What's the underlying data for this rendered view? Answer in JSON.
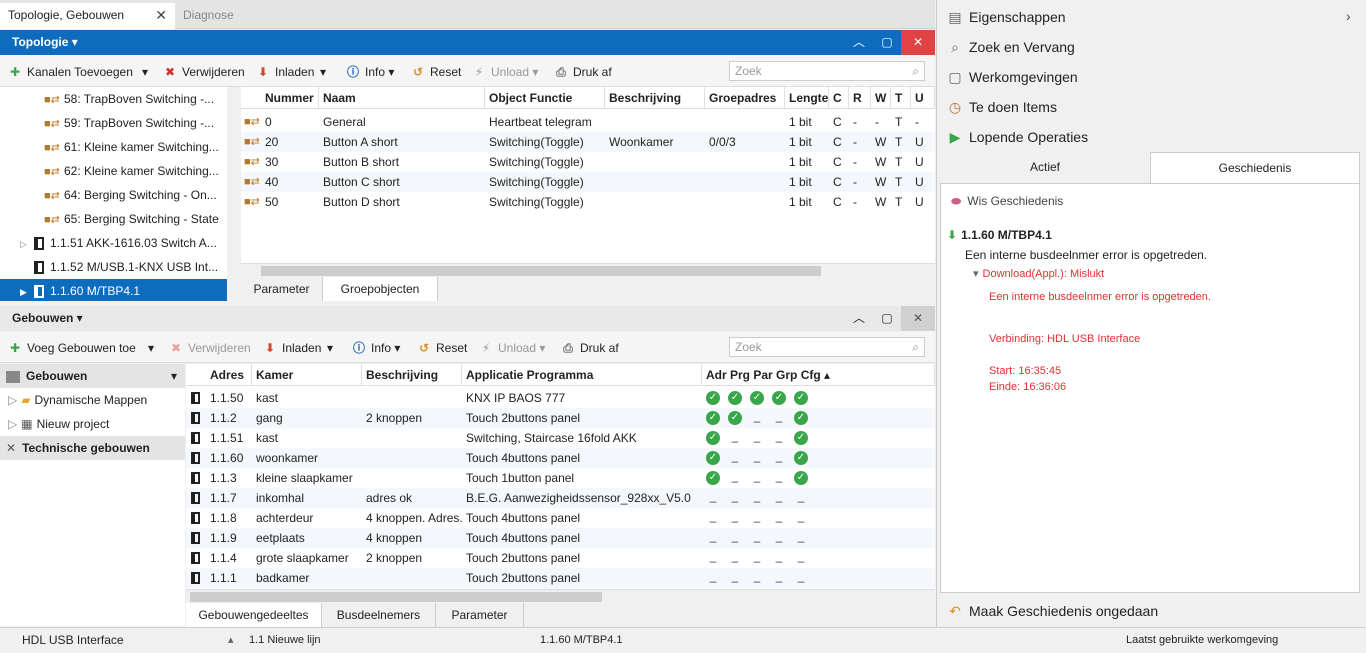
{
  "doc_tabs": {
    "active": "Topologie, Gebouwen",
    "inactive": "Diagnose",
    "close": "✕"
  },
  "topology": {
    "header": "Topologie ▾",
    "toolbar": {
      "add": "Kanalen Toevoegen",
      "remove": "Verwijderen",
      "load": "Inladen",
      "info": "Info",
      "reset": "Reset",
      "unload": "Unload",
      "print": "Druk af",
      "search_placeholder": "Zoek"
    },
    "tree": [
      {
        "label": "58: TrapBoven Switching  -...",
        "type": "co"
      },
      {
        "label": "59: TrapBoven Switching  -...",
        "type": "co"
      },
      {
        "label": "61: Kleine kamer Switching...",
        "type": "co"
      },
      {
        "label": "62: Kleine kamer Switching...",
        "type": "co"
      },
      {
        "label": "64: Berging Switching  - On...",
        "type": "co"
      },
      {
        "label": "65: Berging Switching  - State",
        "type": "co"
      },
      {
        "label": "1.1.51 AKK-1616.03 Switch A...",
        "type": "dev"
      },
      {
        "label": "1.1.52 M/USB.1-KNX USB Int...",
        "type": "dev"
      },
      {
        "label": "1.1.60 M/TBP4.1",
        "type": "dev",
        "selected": true
      }
    ],
    "columns": [
      "Nummer",
      "Naam",
      "Object Functie",
      "Beschrijving",
      "Groepadres",
      "Lengte",
      "C",
      "R",
      "W",
      "T",
      "U"
    ],
    "rows": [
      [
        "0",
        "General",
        "Heartbeat telegram",
        "",
        "",
        "1 bit",
        "C",
        "-",
        "-",
        "T",
        "-"
      ],
      [
        "20",
        "Button A short",
        "Switching(Toggle)",
        "Woonkamer",
        "0/0/3",
        "1 bit",
        "C",
        "-",
        "W",
        "T",
        "U"
      ],
      [
        "30",
        "Button B short",
        "Switching(Toggle)",
        "",
        "",
        "1 bit",
        "C",
        "-",
        "W",
        "T",
        "U"
      ],
      [
        "40",
        "Button C short",
        "Switching(Toggle)",
        "",
        "",
        "1 bit",
        "C",
        "-",
        "W",
        "T",
        "U"
      ],
      [
        "50",
        "Button D short",
        "Switching(Toggle)",
        "",
        "",
        "1 bit",
        "C",
        "-",
        "W",
        "T",
        "U"
      ]
    ],
    "bottom_tabs": [
      "Parameter",
      "Groepobjecten"
    ]
  },
  "buildings": {
    "header": "Gebouwen ▾",
    "toolbar": {
      "add": "Voeg Gebouwen toe",
      "remove": "Verwijderen",
      "load": "Inladen",
      "info": "Info",
      "reset": "Reset",
      "unload": "Unload",
      "print": "Druk af",
      "search_placeholder": "Zoek"
    },
    "sidebar_header": "Gebouwen",
    "tree": [
      "Dynamische Mappen",
      "Nieuw project"
    ],
    "tech_label": "Technische gebouwen",
    "columns": [
      "Adres",
      "Kamer",
      "Beschrijving",
      "Applicatie Programma",
      "Adr Prg Par Grp Cfg ▴"
    ],
    "rows": [
      {
        "adres": "1.1.50",
        "kamer": "kast",
        "beschr": "",
        "app": "KNX IP BAOS 777",
        "status": [
          1,
          1,
          1,
          1,
          1
        ]
      },
      {
        "adres": "1.1.2",
        "kamer": "gang",
        "beschr": "2 knoppen",
        "app": "Touch 2buttons panel",
        "status": [
          1,
          1,
          0,
          0,
          1
        ]
      },
      {
        "adres": "1.1.51",
        "kamer": "kast",
        "beschr": "",
        "app": "Switching, Staircase 16fold AKK",
        "status": [
          1,
          0,
          0,
          0,
          1
        ]
      },
      {
        "adres": "1.1.60",
        "kamer": "woonkamer",
        "beschr": "",
        "app": "Touch 4buttons panel",
        "status": [
          1,
          0,
          0,
          0,
          1
        ]
      },
      {
        "adres": "1.1.3",
        "kamer": "kleine slaapkamer",
        "beschr": "",
        "app": "Touch 1button panel",
        "status": [
          1,
          0,
          0,
          0,
          1
        ]
      },
      {
        "adres": "1.1.7",
        "kamer": "inkomhal",
        "beschr": "adres ok",
        "app": "B.E.G. Aanwezigheidssensor_928xx_V5.0",
        "status": [
          0,
          0,
          0,
          0,
          0
        ]
      },
      {
        "adres": "1.1.8",
        "kamer": "achterdeur",
        "beschr": "4 knoppen. Adres...",
        "app": "Touch 4buttons panel",
        "status": [
          0,
          0,
          0,
          0,
          0
        ]
      },
      {
        "adres": "1.1.9",
        "kamer": "eetplaats",
        "beschr": "4 knoppen",
        "app": "Touch 4buttons panel",
        "status": [
          0,
          0,
          0,
          0,
          0
        ]
      },
      {
        "adres": "1.1.4",
        "kamer": "grote slaapkamer",
        "beschr": "2 knoppen",
        "app": "Touch 2buttons panel",
        "status": [
          0,
          0,
          0,
          0,
          0
        ]
      },
      {
        "adres": "1.1.1",
        "kamer": "badkamer",
        "beschr": "",
        "app": "Touch 2buttons panel",
        "status": [
          0,
          0,
          0,
          0,
          0
        ]
      }
    ],
    "bottom_tabs": [
      "Gebouwengedeeltes",
      "Busdeelnemers",
      "Parameter"
    ]
  },
  "right_panel": {
    "items": [
      "Eigenschappen",
      "Zoek en Vervang",
      "Werkomgevingen",
      "Te doen Items",
      "Lopende Operaties"
    ],
    "tabs": [
      "Actief",
      "Geschiedenis"
    ],
    "clear": "Wis Geschiedenis",
    "entry_title": "1.1.60 M/TBP4.1",
    "entry_msg": "Een interne busdeelnmer error is opgetreden.",
    "download": "Download(Appl.): Mislukt",
    "detail_msg": "Een interne busdeelnmer error is opgetreden.",
    "connection": "Verbinding: HDL USB Interface",
    "start": "Start: 16:35:45",
    "end": "Einde: 16:36:06",
    "undo": "Maak Geschiedenis ongedaan"
  },
  "statusbar": {
    "interface": "HDL USB Interface",
    "line": "1.1 Nieuwe lijn",
    "device": "1.1.60 M/TBP4.1",
    "workspace": "Laatst gebruikte werkomgeving"
  },
  "colors": {
    "accent": "#0e6cbf",
    "error": "#e03030",
    "ok": "#3aa64a"
  }
}
